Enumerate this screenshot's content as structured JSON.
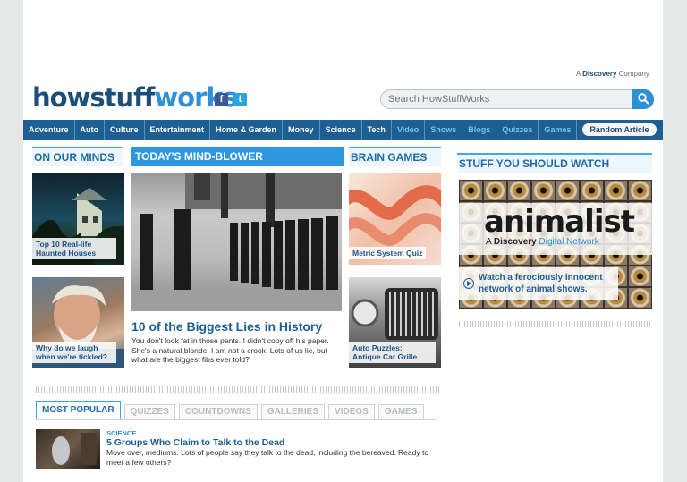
{
  "header": {
    "discovery_tag_prefix": "A",
    "discovery_tag_brand": "Discovery",
    "discovery_tag_suffix": "Company",
    "logo_part1": "howstuff",
    "logo_part2": "works",
    "search_placeholder": "Search HowStuffWorks",
    "social": {
      "facebook": "f",
      "twitter": "t"
    }
  },
  "nav": {
    "items": [
      "Adventure",
      "Auto",
      "Culture",
      "Entertainment",
      "Home & Garden",
      "Money",
      "Science",
      "Tech",
      "Video",
      "Shows",
      "Blogs",
      "Quizzes",
      "Games"
    ],
    "random_label": "Random Article"
  },
  "on_our_minds": {
    "heading": "ON OUR MINDS",
    "items": [
      {
        "caption": "Top 10 Real-life Haunted Houses"
      },
      {
        "caption": "Why do we laugh when we're tickled?"
      }
    ]
  },
  "mind_blower": {
    "heading": "TODAY'S MIND-BLOWER",
    "title": "10 of the Biggest Lies in History",
    "description": "You don't look fat in those pants. I didn't copy off his paper. She's a natural blonde. I am not a crook. Lots of us lie, but what are the biggest fibs ever told?"
  },
  "brain_games": {
    "heading": "BRAIN GAMES",
    "items": [
      {
        "caption": "Metric System Quiz"
      },
      {
        "caption": "Auto Puzzles: Antique Car Grille"
      }
    ]
  },
  "stuff_to_watch": {
    "heading": "STUFF YOU SHOULD WATCH",
    "brand": "animalist",
    "sub_prefix": "A",
    "sub_brand": "Discovery",
    "sub_suffix": "Digital Network",
    "cta": "Watch a ferociously innocent network of animal shows."
  },
  "tabs": {
    "items": [
      "MOST POPULAR",
      "QUIZZES",
      "COUNTDOWNS",
      "GALLERIES",
      "VIDEOS",
      "GAMES"
    ],
    "active_index": 0
  },
  "most_popular": {
    "category": "SCIENCE",
    "title": "5 Groups Who Claim to Talk to the Dead",
    "description": "Move over, mediums. Lots of people say they talk to the dead, including the bereaved. Ready to meet a few others?"
  },
  "colors": {
    "nav_bg": "#1d5f93",
    "accent": "#2d97e0",
    "link": "#1d5f93"
  }
}
